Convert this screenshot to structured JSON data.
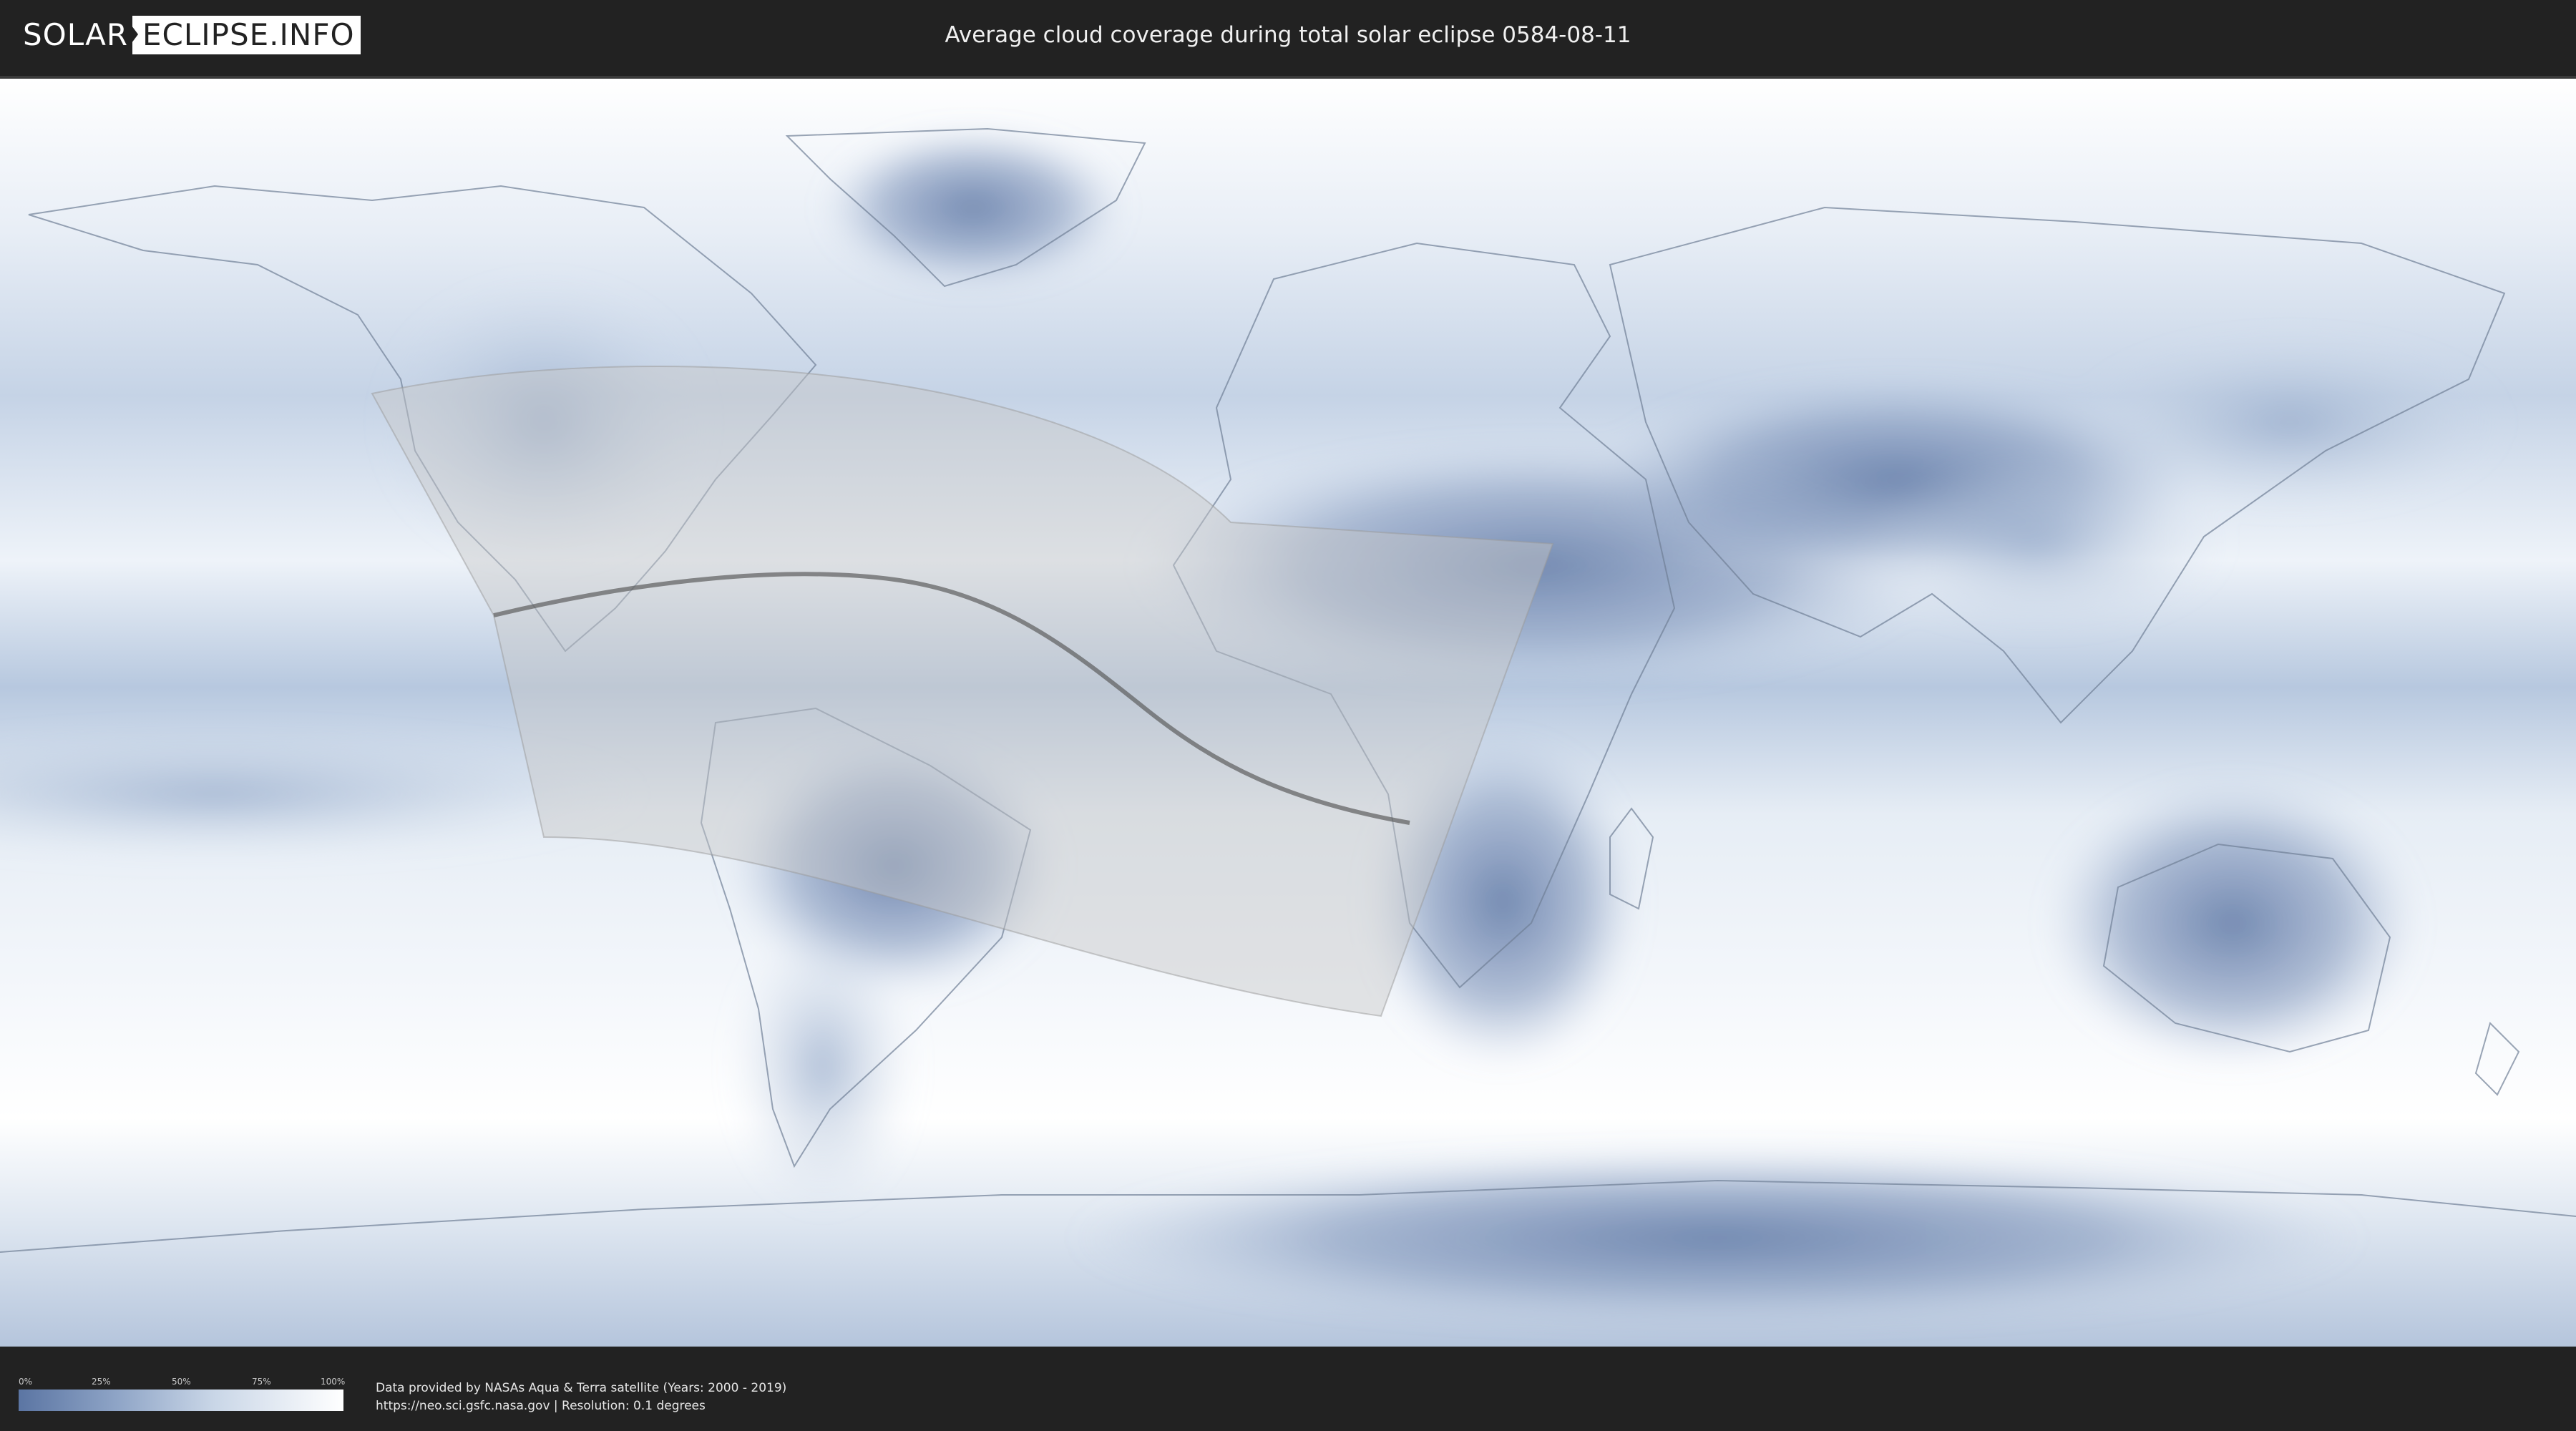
{
  "header": {
    "logo_left": "SOLAR",
    "logo_right": "ECLIPSE.INFO",
    "title": "Average cloud coverage during total solar eclipse 0584-08-11"
  },
  "map": {
    "colors": {
      "clear": "#5b75a3",
      "mid": "#a9bbd7",
      "cloudy": "#ffffff",
      "eclipse_overlay": "#c8c8c8",
      "centerline": "#555555"
    }
  },
  "legend": {
    "ticks": [
      "0%",
      "25%",
      "50%",
      "75%",
      "100%"
    ]
  },
  "credits": {
    "line1": "Data provided by NASAs Aqua & Terra satellite (Years: 2000 - 2019)",
    "line2": "https://neo.sci.gsfc.nasa.gov | Resolution: 0.1 degrees"
  }
}
